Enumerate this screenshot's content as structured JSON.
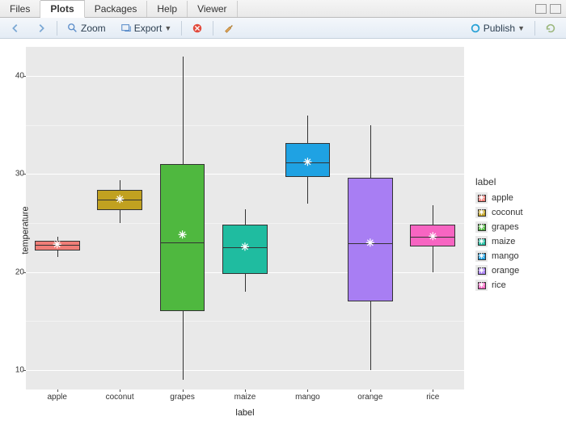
{
  "tabs": [
    "Files",
    "Plots",
    "Packages",
    "Help",
    "Viewer"
  ],
  "active_tab": 1,
  "toolbar": {
    "zoom": "Zoom",
    "export": "Export",
    "publish": "Publish"
  },
  "legend": {
    "title": "label",
    "items": [
      {
        "label": "apple",
        "color": "#f07e78"
      },
      {
        "label": "coconut",
        "color": "#c1a120"
      },
      {
        "label": "grapes",
        "color": "#4fb83f"
      },
      {
        "label": "maize",
        "color": "#1fbca0"
      },
      {
        "label": "mango",
        "color": "#1fa2e3"
      },
      {
        "label": "orange",
        "color": "#a87ef3"
      },
      {
        "label": "rice",
        "color": "#f765c2"
      }
    ]
  },
  "chart_data": {
    "type": "boxplot",
    "xlabel": "label",
    "ylabel": "temperature",
    "ylim": [
      8,
      43
    ],
    "yticks": [
      10,
      20,
      30,
      40
    ],
    "yticks_minor": [
      15,
      25,
      35
    ],
    "categories": [
      "apple",
      "coconut",
      "grapes",
      "maize",
      "mango",
      "orange",
      "rice"
    ],
    "series": [
      {
        "name": "apple",
        "color": "#f07e78",
        "low": 21.5,
        "q1": 22.2,
        "median": 22.8,
        "q3": 23.2,
        "high": 23.6,
        "mean": 22.8
      },
      {
        "name": "coconut",
        "color": "#c1a120",
        "low": 25.0,
        "q1": 26.3,
        "median": 27.4,
        "q3": 28.4,
        "high": 29.4,
        "mean": 27.4
      },
      {
        "name": "grapes",
        "color": "#4fb83f",
        "low": 9.0,
        "q1": 16.0,
        "median": 23.0,
        "q3": 31.0,
        "high": 42.0,
        "mean": 23.8
      },
      {
        "name": "maize",
        "color": "#1fbca0",
        "low": 18.0,
        "q1": 19.8,
        "median": 22.5,
        "q3": 24.8,
        "high": 26.4,
        "mean": 22.5
      },
      {
        "name": "mango",
        "color": "#1fa2e3",
        "low": 27.0,
        "q1": 29.7,
        "median": 31.2,
        "q3": 33.2,
        "high": 36.0,
        "mean": 31.2
      },
      {
        "name": "orange",
        "color": "#a87ef3",
        "low": 10.0,
        "q1": 17.0,
        "median": 22.9,
        "q3": 29.6,
        "high": 35.0,
        "mean": 22.9
      },
      {
        "name": "rice",
        "color": "#f765c2",
        "low": 20.0,
        "q1": 22.6,
        "median": 23.6,
        "q3": 24.8,
        "high": 26.8,
        "mean": 23.6
      }
    ]
  }
}
